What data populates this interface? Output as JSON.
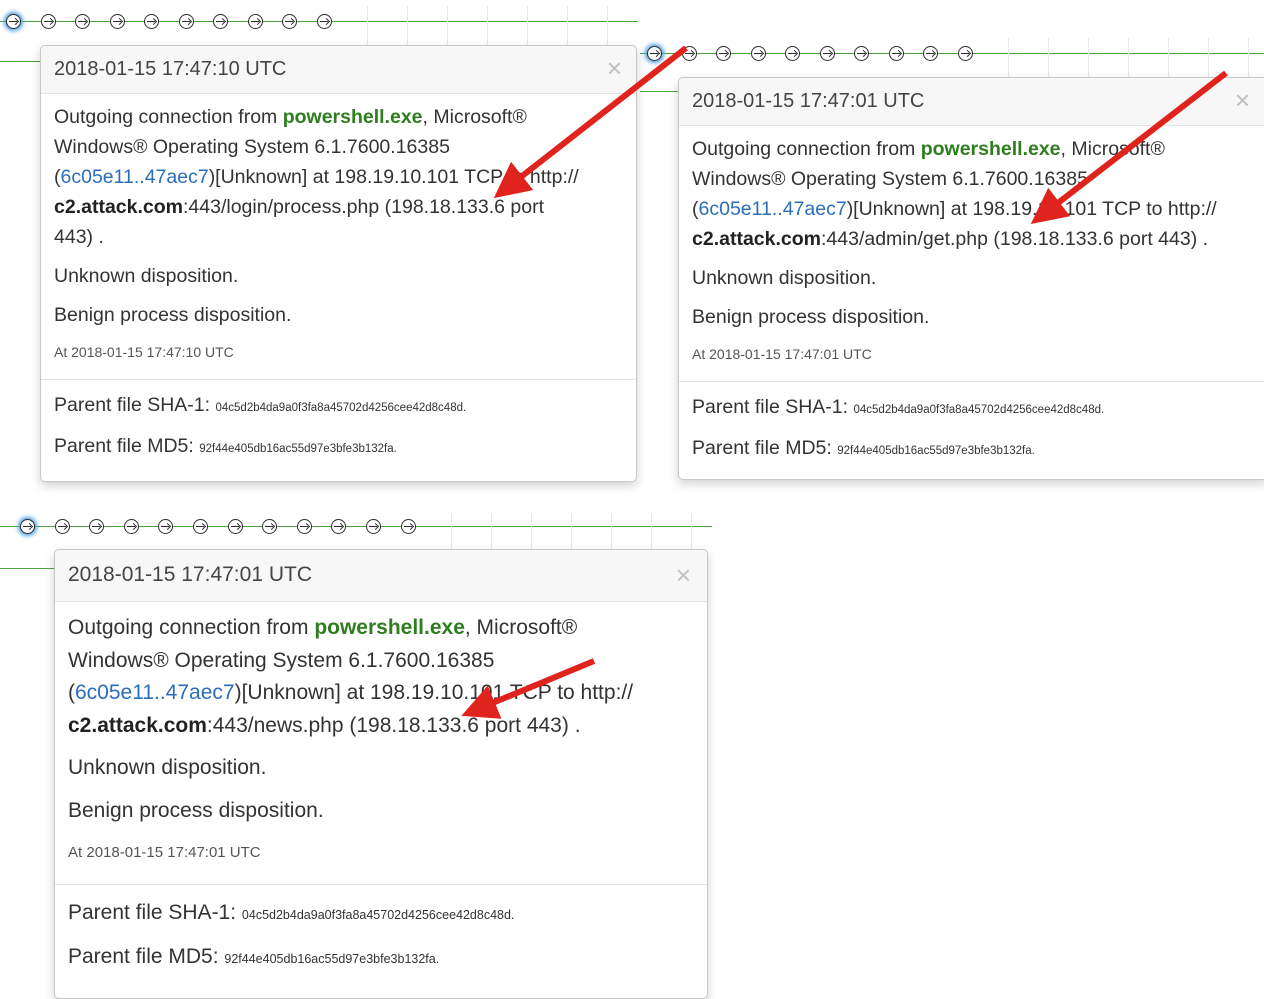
{
  "panels": [
    {
      "timestamp": "2018-01-15  17:47:10  UTC",
      "close": "×",
      "line1_pre": "Outgoing connection from ",
      "process": "powershell.exe",
      "line1_post": ", Microsoft®",
      "line2": "Windows® Operating System 6.1.7600.16385",
      "hash_link": "6c05e11..47aec7",
      "line3_post": ")[Unknown] at 198.19.10.101 TCP to http://",
      "host": "c2.attack.com",
      "path": ":443/login/process.php (198.18.133.6 port",
      "path2": "443) .",
      "disposition": "Unknown disposition.",
      "process_disposition": "Benign process disposition.",
      "at_label": "At",
      "at_time": "2018-01-15  17:47:10  UTC",
      "sha1_label": "Parent file SHA-1:",
      "sha1": "04c5d2b4da9a0f3fa8a45702d4256cee42d8c48d.",
      "md5_label": "Parent file MD5:",
      "md5": "92f44e405db16ac55d97e3bfe3b132fa."
    },
    {
      "timestamp": "2018-01-15  17:47:01  UTC",
      "close": "×",
      "line1_pre": "Outgoing connection from ",
      "process": "powershell.exe",
      "line1_post": ", Microsoft®",
      "line2": "Windows® Operating System 6.1.7600.16385",
      "hash_link": "6c05e11..47aec7",
      "line3_post": ")[Unknown] at 198.19.10.101 TCP to http://",
      "host": "c2.attack.com",
      "path": ":443/admin/get.php (198.18.133.6 port 443) .",
      "path2": "",
      "disposition": "Unknown disposition.",
      "process_disposition": "Benign process disposition.",
      "at_label": "At",
      "at_time": "2018-01-15  17:47:01  UTC",
      "sha1_label": "Parent file SHA-1:",
      "sha1": "04c5d2b4da9a0f3fa8a45702d4256cee42d8c48d.",
      "md5_label": "Parent file MD5:",
      "md5": "92f44e405db16ac55d97e3bfe3b132fa."
    },
    {
      "timestamp": "2018-01-15  17:47:01  UTC",
      "close": "×",
      "line1_pre": "Outgoing connection from ",
      "process": "powershell.exe",
      "line1_post": ", Microsoft®",
      "line2": "Windows® Operating System 6.1.7600.16385",
      "hash_link": "6c05e11..47aec7",
      "line3_post": ")[Unknown] at 198.19.10.101 TCP to http://",
      "host": "c2.attack.com",
      "path": ":443/news.php (198.18.133.6 port 443) .",
      "path2": "",
      "disposition": "Unknown disposition.",
      "process_disposition": "Benign process disposition.",
      "at_label": "At",
      "at_time": "2018-01-15  17:47:01  UTC",
      "sha1_label": "Parent file SHA-1:",
      "sha1": "04c5d2b4da9a0f3fa8a45702d4256cee42d8c48d.",
      "md5_label": "Parent file MD5:",
      "md5": "92f44e405db16ac55d97e3bfe3b132fa."
    }
  ],
  "timelines": [
    {
      "node_count": 10
    },
    {
      "node_count": 10
    },
    {
      "node_count": 12
    }
  ],
  "colors": {
    "process_green": "#2e7d1e",
    "link_blue": "#2a6ebb",
    "timeline_green": "#4aa53a",
    "annotation_arrow": "#e0231c",
    "active_glow": "#4a9de0"
  },
  "icons": {
    "node": "right-arrow-circle-icon",
    "close": "close-icon",
    "annotation": "red-arrow-annotation"
  }
}
